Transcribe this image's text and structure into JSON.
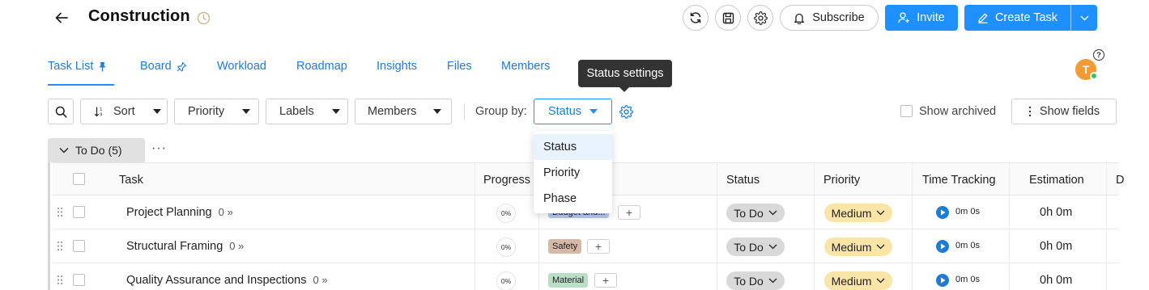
{
  "header": {
    "title": "Construction",
    "subscribe_label": "Subscribe",
    "invite_label": "Invite",
    "create_task_label": "Create Task"
  },
  "tabs": [
    {
      "label": "Task List",
      "active": true,
      "icon": "pin-filled-icon"
    },
    {
      "label": "Board",
      "icon": "pin-outline-icon"
    },
    {
      "label": "Workload"
    },
    {
      "label": "Roadmap"
    },
    {
      "label": "Insights"
    },
    {
      "label": "Files"
    },
    {
      "label": "Members"
    }
  ],
  "tooltip": "Status settings",
  "user": {
    "avatar_initial": "T",
    "help": "?"
  },
  "toolbar": {
    "sort_label": "Sort",
    "priority_label": "Priority",
    "labels_label": "Labels",
    "members_label": "Members",
    "group_by_label": "Group by:",
    "group_by_value": "Status",
    "show_archived_label": "Show archived",
    "show_fields_label": "Show fields"
  },
  "group_by_options": [
    "Status",
    "Priority",
    "Phase"
  ],
  "group": {
    "label": "To Do (5)",
    "more": "···"
  },
  "table": {
    "columns": [
      "Task",
      "Progress",
      "Status",
      "Priority",
      "Time Tracking",
      "Estimation",
      "D"
    ],
    "rows": [
      {
        "task": "Project Planning",
        "subtasks": "0",
        "progress": "0%",
        "tag": "Budget and...",
        "status": "To Do",
        "priority": "Medium",
        "time": "0m 0s",
        "estimation": "0h 0m"
      },
      {
        "task": "Structural Framing",
        "subtasks": "0",
        "progress": "0%",
        "tag": "Safety",
        "status": "To Do",
        "priority": "Medium",
        "time": "0m 0s",
        "estimation": "0h 0m"
      },
      {
        "task": "Quality Assurance and Inspections",
        "subtasks": "0",
        "progress": "0%",
        "tag": "Material",
        "status": "To Do",
        "priority": "Medium",
        "time": "0m 0s",
        "estimation": "0h 0m"
      }
    ]
  },
  "colors": {
    "accent": "#1e90ff",
    "tag_budget": "#b7c8ee",
    "tag_safety": "#d6b8a8",
    "tag_material": "#b9e0c6",
    "medium": "#f9e5a7"
  }
}
